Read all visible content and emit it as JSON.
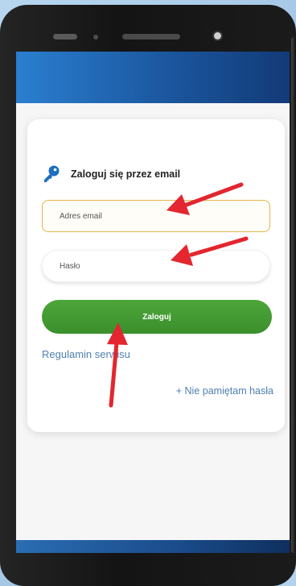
{
  "login": {
    "title": "Zaloguj się przez email",
    "email_placeholder": "Adres email",
    "password_placeholder": "Hasło",
    "login_button": "Zaloguj",
    "terms_link": "Regulamin serwisu",
    "forgot_password_link": "+ Nie pamiętam hasła"
  },
  "icons": {
    "title_icon": "key-icon"
  },
  "colors": {
    "header_blue": "#1c5aa3",
    "login_button_green": "#3e9a2f",
    "email_border_highlight": "#e6b74a",
    "link_blue": "#4f7fb2",
    "arrow_red": "#e3262f"
  }
}
